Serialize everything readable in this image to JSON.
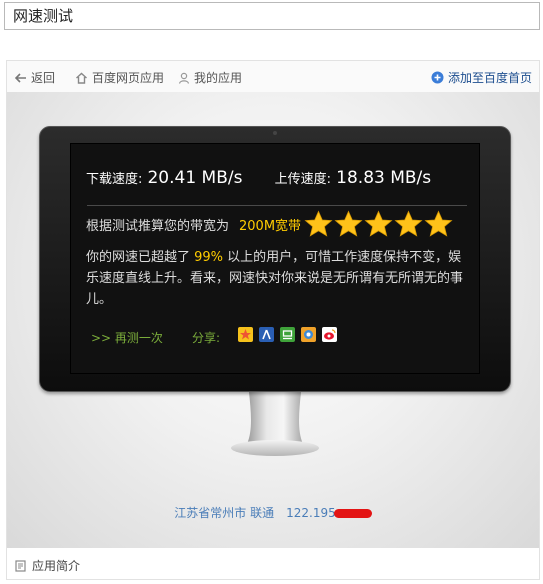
{
  "search": {
    "query": "网速测试"
  },
  "toolbar": {
    "back_label": "返回",
    "baidu_apps_label": "百度网页应用",
    "my_apps_label": "我的应用",
    "add_home_label": "添加至百度首页"
  },
  "result": {
    "download_label": "下载速度:",
    "download_value": "20.41 MB/s",
    "upload_label": "上传速度:",
    "upload_value": "18.83 MB/s",
    "bandwidth_prefix": "根据测试推算您的带宽为",
    "bandwidth_value": "200M宽带",
    "star_count": 5,
    "star_color": "#ffc21a",
    "desc_part1": "你的网速已超越了 ",
    "percent": "99%",
    "desc_part2": " 以上的用户，可惜工作速度保持不变，娱乐速度直线上升。看来，网速快对你来说是无所谓有无所谓无的事儿。",
    "retry_label": ">> 再测一次",
    "share_label": "分享:",
    "share_icons": [
      "qzone-icon",
      "renren-icon",
      "douban-icon",
      "kaixin-icon",
      "weibo-icon"
    ]
  },
  "location": {
    "region": "江苏省常州市 联通",
    "ip": "122.195"
  },
  "footer": {
    "intro_label": "应用简介"
  },
  "colors": {
    "accent_yellow": "#ffcc00",
    "link_blue": "#4a7db8",
    "green": "#7cae3b"
  }
}
